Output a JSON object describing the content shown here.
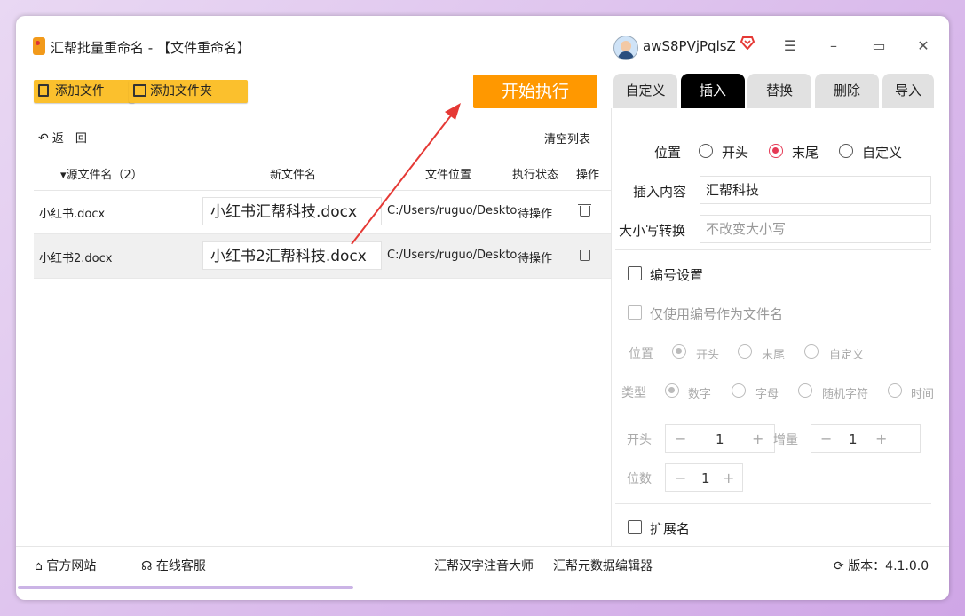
{
  "titlebar": {
    "title": "汇帮批量重命名 - 【文件重命名】",
    "username": "awS8PVjPqlsZ",
    "vip_icon": "vip-heart-icon",
    "minimize": "–",
    "maximize": "▭",
    "close": "✕",
    "menu": "☰"
  },
  "toolbar": {
    "add_file": "添加文件",
    "add_folder": "添加文件夹",
    "start": "开始执行"
  },
  "list": {
    "back": "返　回",
    "clear": "清空列表",
    "columns": {
      "source": "▾源文件名（2）",
      "new_name": "新文件名",
      "location": "文件位置",
      "status": "执行状态",
      "action": "操作"
    },
    "rows": [
      {
        "source": "小红书.docx",
        "new_name": "小红书汇帮科技.docx",
        "location": "C:/Users/ruguo/Deskto",
        "status": "待操作"
      },
      {
        "source": "小红书2.docx",
        "new_name": "小红书2汇帮科技.docx",
        "location": "C:/Users/ruguo/Deskto",
        "status": "待操作"
      }
    ]
  },
  "tabs": [
    "自定义",
    "插入",
    "替换",
    "删除",
    "导入"
  ],
  "insert": {
    "position_label": "位置",
    "positions": [
      "开头",
      "末尾",
      "自定义"
    ],
    "content_label": "插入内容",
    "content_value": "汇帮科技",
    "case_label": "大小写转换",
    "case_placeholder": "不改变大小写"
  },
  "numbering": {
    "label": "编号设置",
    "only_number": "仅使用编号作为文件名",
    "position_label": "位置",
    "positions": [
      "开头",
      "末尾",
      "自定义"
    ],
    "type_label": "类型",
    "types": [
      "数字",
      "字母",
      "随机字符",
      "时间"
    ],
    "start_label": "开头",
    "start_value": "1",
    "increment_label": "增量",
    "increment_value": "1",
    "digits_label": "位数",
    "digits_value": "1",
    "minus": "−",
    "plus": "+"
  },
  "extension": {
    "label": "扩展名"
  },
  "footer": {
    "website": "官方网站",
    "service": "在线客服",
    "link1": "汇帮汉字注音大师",
    "link2": "汇帮元数据编辑器",
    "version": "版本：4.1.0.0"
  },
  "colors": {
    "accent_orange": "#ff9800",
    "button_yellow": "#fbc02d",
    "radio_selected": "#e53955",
    "annotation_arrow": "#e53935"
  }
}
